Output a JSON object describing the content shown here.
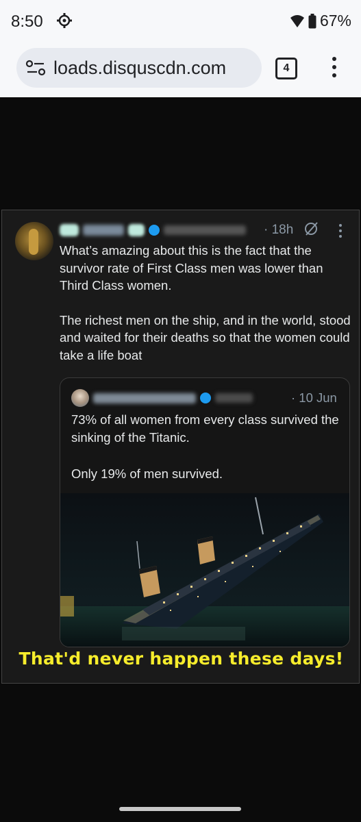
{
  "status_bar": {
    "time": "8:50",
    "battery": "67%"
  },
  "browser": {
    "url": "loads.disquscdn.com",
    "tab_count": "4"
  },
  "post": {
    "time": "· 18h",
    "paragraphs": [
      "What’s amazing about this is the fact that the survivor rate of First Class men was lower than Third Class women.",
      "The richest men on the ship, and in the world, stood and waited for their deaths so that the women could take a life boat"
    ],
    "quote": {
      "time": "· 10 Jun",
      "paragraphs": [
        "73% of all women from every class survived the sinking of the Titanic.",
        "Only 19% of men survived."
      ]
    },
    "caption": "That'd never happen these days!"
  },
  "colors": {
    "caption": "#f6ec2c",
    "verified": "#1d9bf0",
    "background": "#0b0b0b"
  }
}
